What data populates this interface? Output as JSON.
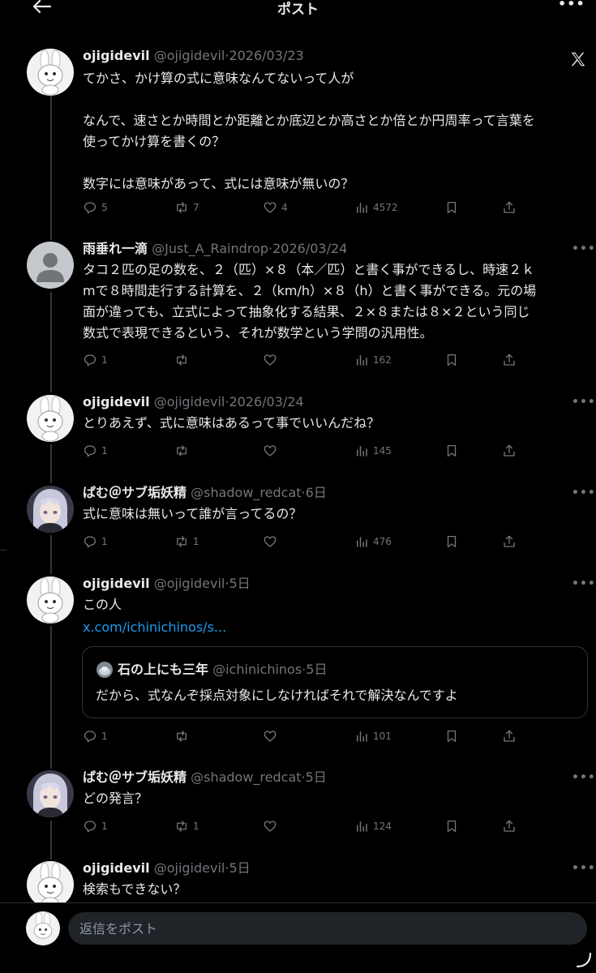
{
  "header": {
    "title": "ポスト",
    "back_icon": "back-arrow-icon",
    "more_icon": "more-horizontal-icon",
    "more_label": "•••"
  },
  "posts": [
    {
      "name": "ojigidevil",
      "handle": "@ojigidevil",
      "separator": "·",
      "date": "2026/03/23",
      "avatar": "rabbit-character-avatar",
      "text": "てかさ、かけ算の式に意味なんてないって人が\n\nなんで、速さとか時間とか距離とか底辺とか高さとか倍とか円周率って言葉を\n使ってかけ算を書くの？\n\n数字には意味があって、式には意味が無いの？",
      "reply_count": "5",
      "repost_count": "7",
      "like_count": "4",
      "view_count": "4572"
    },
    {
      "name": "雨垂れ一滴",
      "handle": "@Just_A_Raindrop",
      "separator": "·",
      "date": "2026/03/24",
      "avatar": "default-user-avatar",
      "text": "タコ２匹の足の数を、２（匹）×８（本／匹）と書く事ができるし、時速２ｋ\nmで８時間走行する計算を、２（km/h）×８（h）と書く事ができる。元の場\n面が違っても、立式によって抽象化する結果、２×８または８×２という同じ\n数式で表現できるという、それが数学という学問の汎用性。",
      "reply_count": "1",
      "repost_count": "",
      "like_count": "",
      "view_count": "162"
    },
    {
      "name": "ojigidevil",
      "handle": "@ojigidevil",
      "separator": "·",
      "date": "2026/03/24",
      "avatar": "rabbit-character-avatar",
      "text": "とりあえず、式に意味はあるって事でいいんだね？",
      "reply_count": "1",
      "repost_count": "",
      "like_count": "",
      "view_count": "145"
    },
    {
      "name": "ぱむ＠サブ垢妖精",
      "handle": "@shadow_redcat",
      "separator": "·",
      "date": "6日",
      "avatar": "anime-character-avatar",
      "text": "式に意味は無いって誰が言ってるの？",
      "reply_count": "1",
      "repost_count": "1",
      "like_count": "",
      "view_count": "476"
    },
    {
      "name": "ojigidevil",
      "handle": "@ojigidevil",
      "separator": "·",
      "date": "5日",
      "avatar": "rabbit-character-avatar",
      "text": "この人",
      "link": "x.com/ichinichinos/s...",
      "quote": {
        "name": "石の上にも三年",
        "handle": "@ichinichinos",
        "separator": "·",
        "date": "5日",
        "text": "だから、式なんぞ採点対象にしなければそれで解決なんですよ"
      },
      "reply_count": "1",
      "repost_count": "",
      "like_count": "",
      "view_count": "101"
    },
    {
      "name": "ぱむ＠サブ垢妖精",
      "handle": "@shadow_redcat",
      "separator": "·",
      "date": "5日",
      "avatar": "anime-character-avatar",
      "text": "どの発言？",
      "reply_count": "1",
      "repost_count": "1",
      "like_count": "",
      "view_count": "124"
    },
    {
      "name": "ojigidevil",
      "handle": "@ojigidevil",
      "separator": "·",
      "date": "5日",
      "avatar": "rabbit-character-avatar",
      "text": "検索もできない？"
    }
  ],
  "reply_bar": {
    "placeholder": "返信をポスト"
  },
  "colors": {
    "background": "#000000",
    "text": "#e7e9ea",
    "muted": "#71767b",
    "link": "#1d9bf0",
    "input_bg": "#202327"
  }
}
